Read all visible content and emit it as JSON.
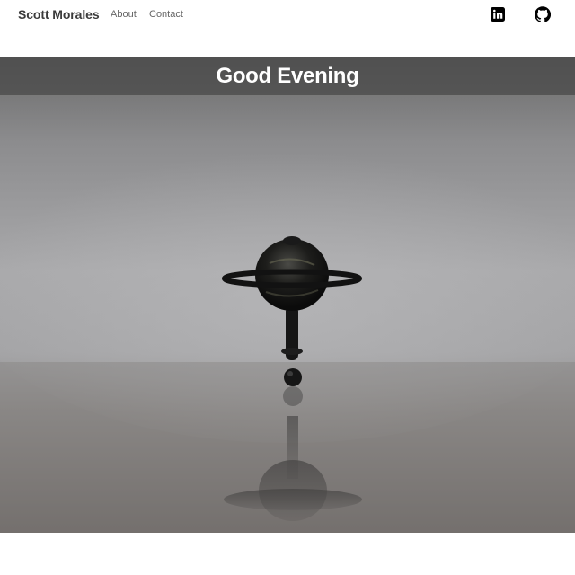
{
  "navbar": {
    "brand": "Scott Morales",
    "links": [
      {
        "label": "About"
      },
      {
        "label": "Contact"
      }
    ],
    "social": [
      {
        "icon": "linkedin-icon"
      },
      {
        "icon": "github-icon"
      }
    ]
  },
  "hero": {
    "greeting": "Good Evening",
    "image_subject": "spinning-top-photo"
  }
}
